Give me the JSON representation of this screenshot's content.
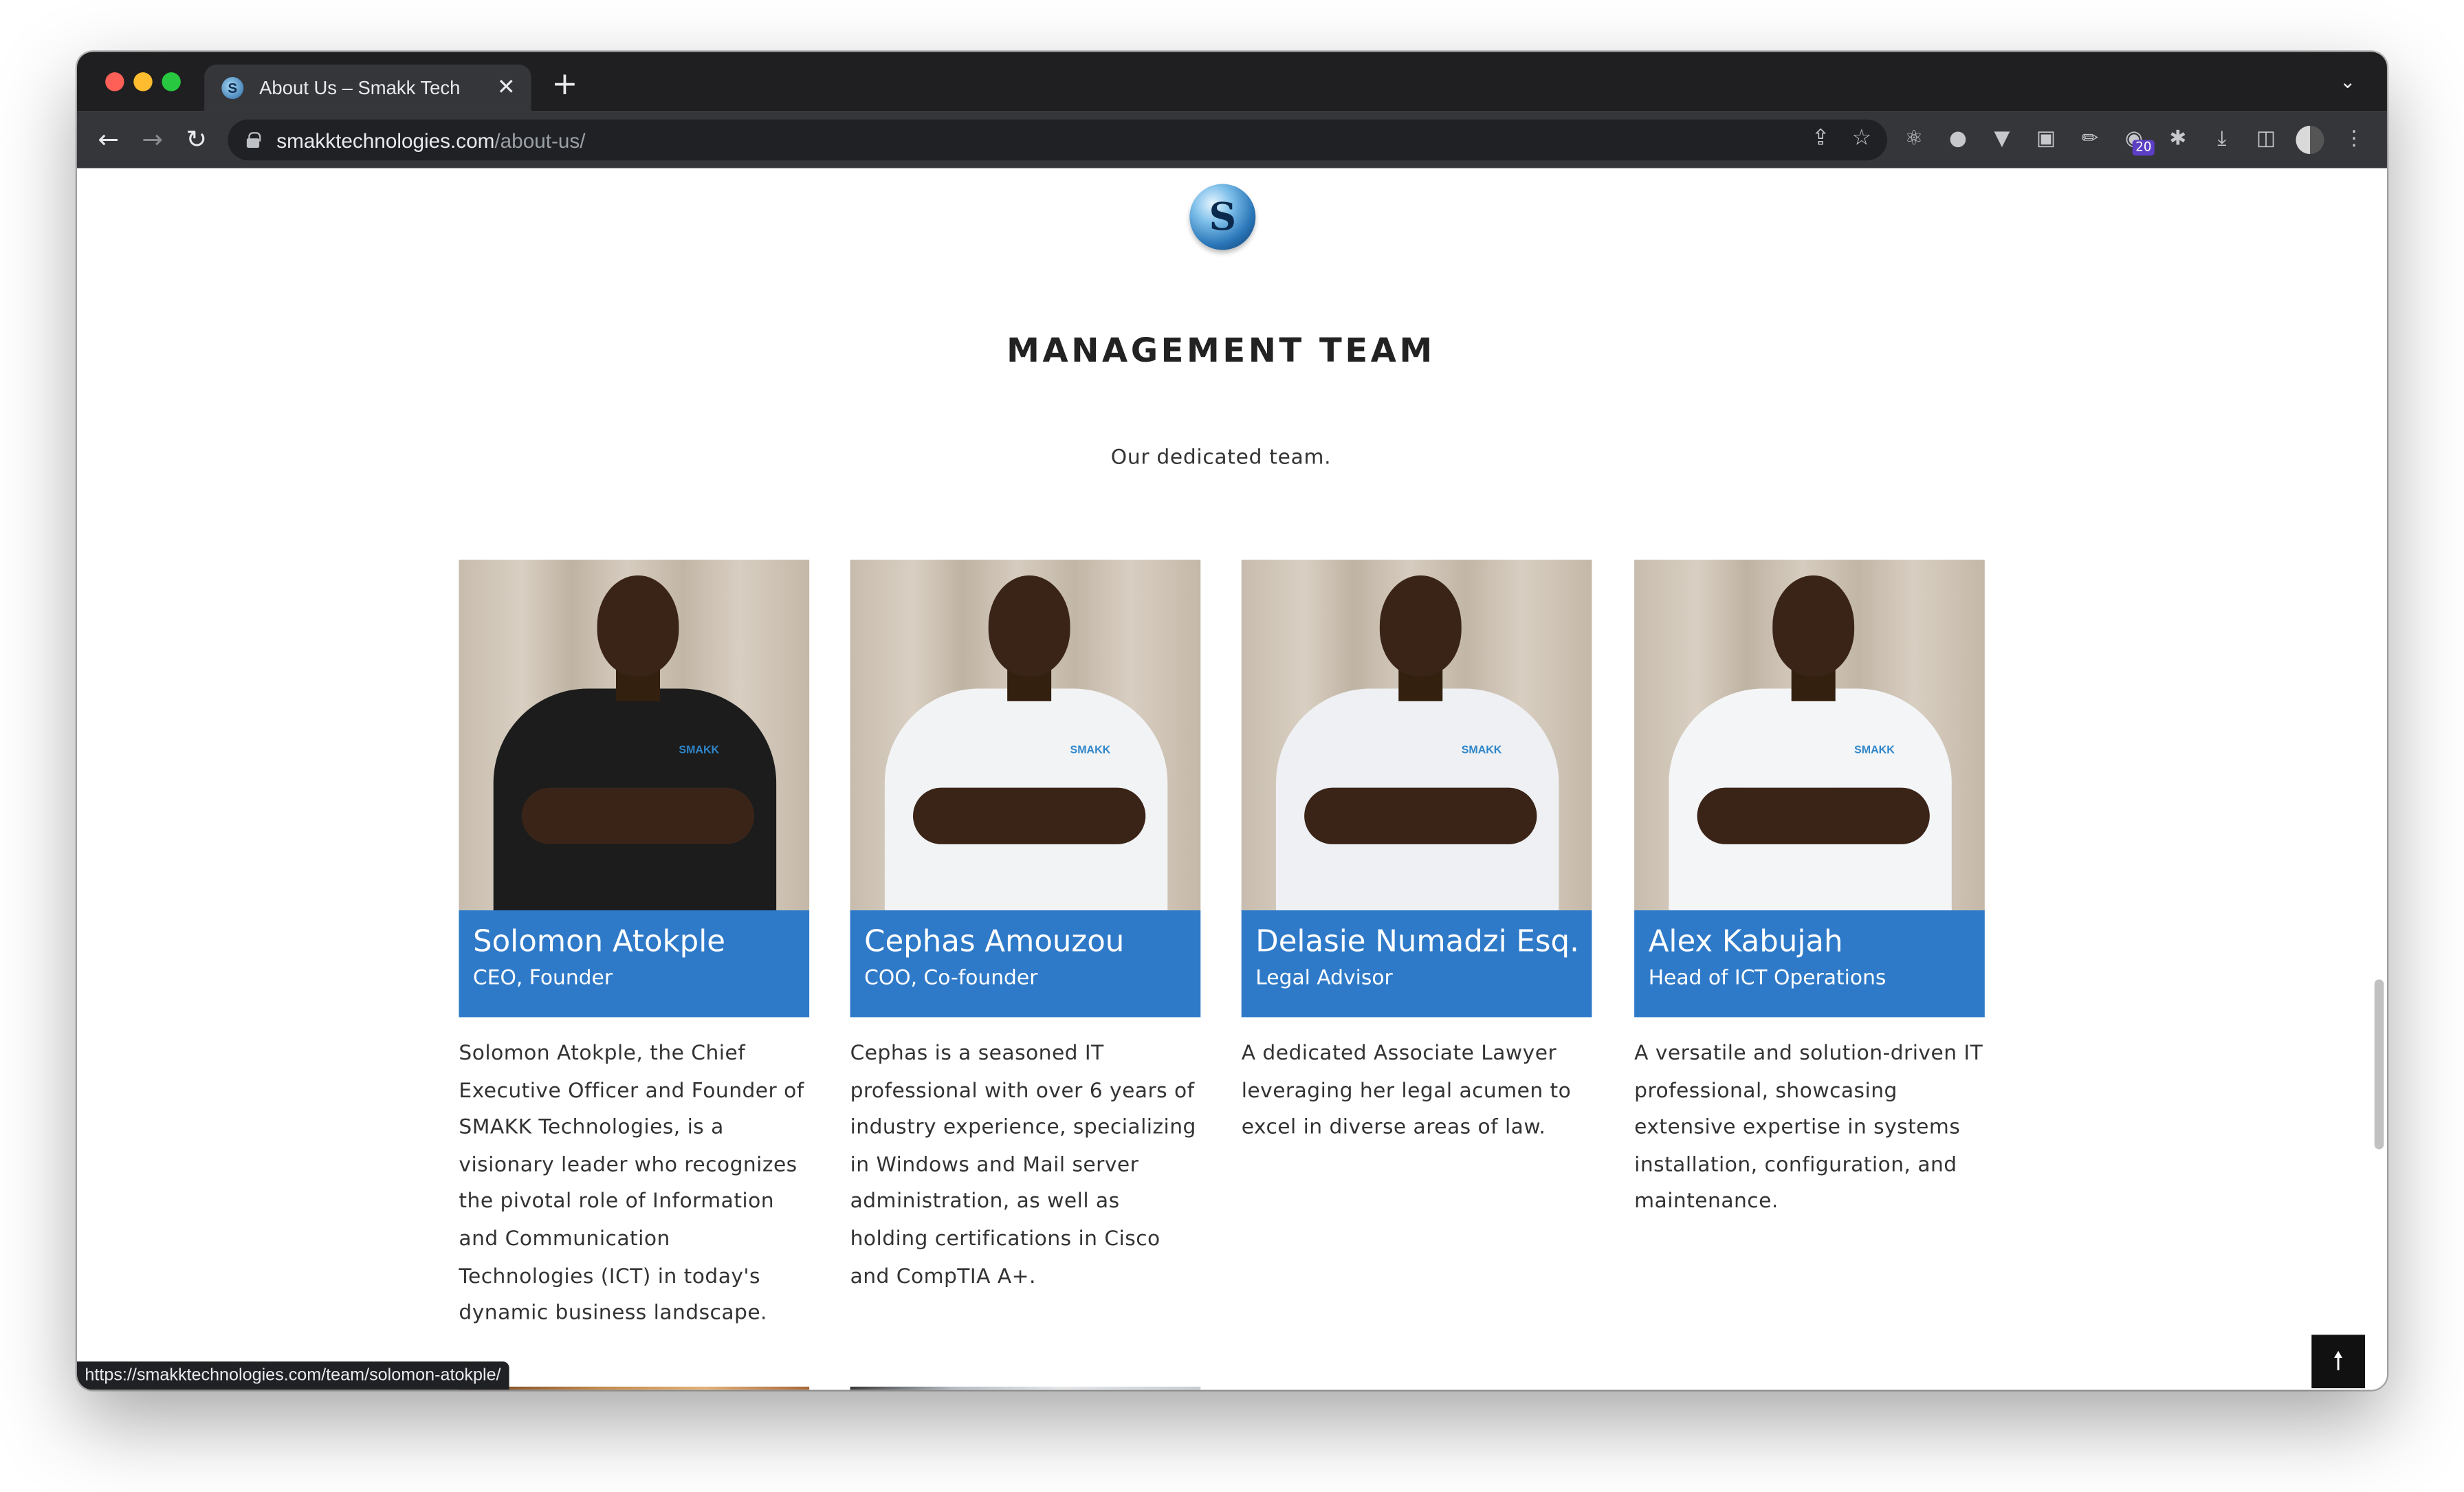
{
  "browser": {
    "tab_title": "About Us – Smakk Tech",
    "tab_close": "✕",
    "new_tab": "+",
    "tab_menu": "⌄",
    "url_host": "smakktechnologies.com",
    "url_path": "/about-us/",
    "extension_badge": "20",
    "status_url": "https://smakktechnologies.com/team/solomon-atokple/"
  },
  "page": {
    "logo_letter": "S",
    "section_title": "MANAGEMENT TEAM",
    "section_subtitle": "Our dedicated team.",
    "back_to_top": "🠕"
  },
  "team": [
    {
      "name": "Solomon Atokple",
      "role": "CEO, Founder",
      "bio": "Solomon Atokple, the Chief Executive Officer and Founder of SMAKK Technologies, is a visionary leader who recognizes the pivotal role of Information and Communication Technologies (ICT) in today's dynamic business landscape.",
      "shirt_color": "#1c1c1c"
    },
    {
      "name": "Cephas Amouzou",
      "role": "COO, Co-founder",
      "bio": "Cephas is a seasoned IT professional with over 6 years of industry experience, specializing in Windows and Mail server administration, as well as holding certifications in Cisco and CompTIA A+.",
      "shirt_color": "#f2f3f5"
    },
    {
      "name": "Delasie Numadzi Esq.",
      "role": "Legal Advisor",
      "bio": "A dedicated Associate Lawyer leveraging her legal acumen to excel in diverse areas of law.",
      "shirt_color": "#eef0f3"
    },
    {
      "name": "Alex Kabujah",
      "role": "Head of ICT Operations",
      "bio": "A versatile and solution-driven IT professional, showcasing extensive expertise in systems installation, configuration, and maintenance.",
      "shirt_color": "#f4f5f7"
    }
  ],
  "colors": {
    "accent": "#2f7ac8",
    "chrome_dark": "#1f1f21",
    "toolbar": "#35363a"
  }
}
